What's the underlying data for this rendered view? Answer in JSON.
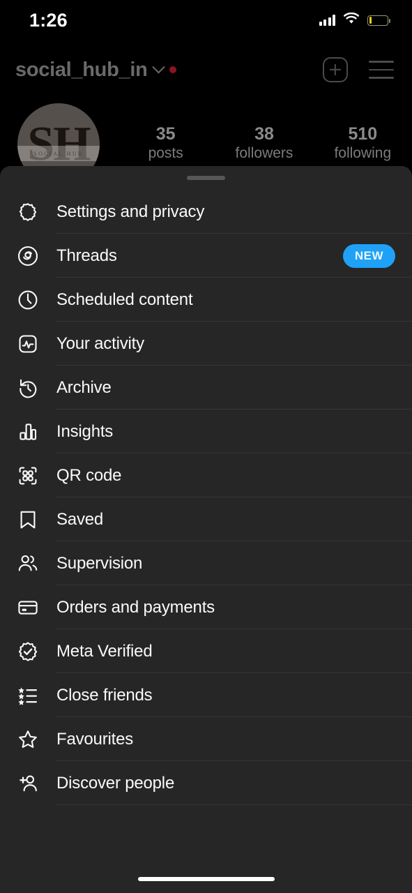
{
  "status_bar": {
    "time": "1:26",
    "signal_icon": "cellular-signal-icon",
    "wifi_icon": "wifi-icon",
    "battery_icon": "battery-low-icon"
  },
  "profile": {
    "username": "social_hub_in",
    "username_chevron_icon": "chevron-down-icon",
    "notification_dot": "red-notification-dot",
    "create_button_icon": "plus-square-icon",
    "menu_button_icon": "hamburger-menu-icon",
    "avatar": {
      "initials": "SH",
      "brand_text": "SOCIAL HUB"
    },
    "stats": [
      {
        "number": "35",
        "label": "posts"
      },
      {
        "number": "38",
        "label": "followers"
      },
      {
        "number": "510",
        "label": "following"
      }
    ]
  },
  "sheet": {
    "handle": "drag-handle",
    "items": [
      {
        "label": "Settings and privacy",
        "icon": "gear-icon",
        "badge": ""
      },
      {
        "label": "Threads",
        "icon": "threads-icon",
        "badge": "NEW"
      },
      {
        "label": "Scheduled content",
        "icon": "clock-icon",
        "badge": ""
      },
      {
        "label": "Your activity",
        "icon": "activity-icon",
        "badge": ""
      },
      {
        "label": "Archive",
        "icon": "archive-clock-icon",
        "badge": ""
      },
      {
        "label": "Insights",
        "icon": "bar-chart-icon",
        "badge": ""
      },
      {
        "label": "QR code",
        "icon": "qr-code-icon",
        "badge": ""
      },
      {
        "label": "Saved",
        "icon": "bookmark-icon",
        "badge": ""
      },
      {
        "label": "Supervision",
        "icon": "two-people-icon",
        "badge": ""
      },
      {
        "label": "Orders and payments",
        "icon": "credit-card-icon",
        "badge": ""
      },
      {
        "label": "Meta Verified",
        "icon": "verified-badge-icon",
        "badge": ""
      },
      {
        "label": "Close friends",
        "icon": "star-list-icon",
        "badge": ""
      },
      {
        "label": "Favourites",
        "icon": "star-icon",
        "badge": ""
      },
      {
        "label": "Discover people",
        "icon": "add-person-icon",
        "badge": ""
      }
    ]
  },
  "colors": {
    "sheet_background": "#262626",
    "screen_background": "#000000",
    "badge_blue": "#1fa1f7",
    "divider": "#363636",
    "notification_red": "#8a1420",
    "battery_yellow": "#f5d117"
  },
  "home_indicator": "home-indicator"
}
